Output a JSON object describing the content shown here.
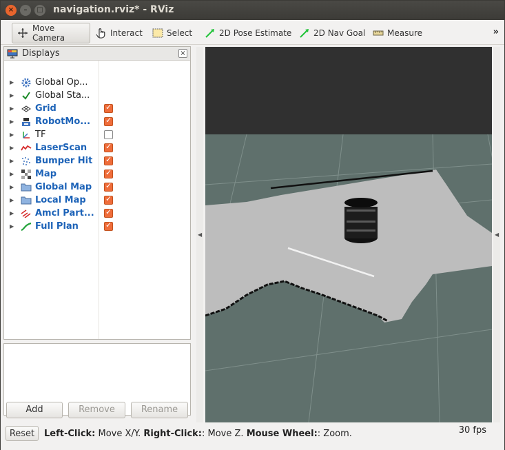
{
  "window": {
    "title": "navigation.rviz* - RViz"
  },
  "toolbar": {
    "tools": [
      {
        "label": "Move Camera",
        "icon": "move-camera-icon"
      },
      {
        "label": "Interact",
        "icon": "hand-pointer-icon"
      },
      {
        "label": "Select",
        "icon": "select-box-icon"
      },
      {
        "label": "2D Pose Estimate",
        "icon": "green-arrow-icon"
      },
      {
        "label": "2D Nav Goal",
        "icon": "green-arrow-icon"
      },
      {
        "label": "Measure",
        "icon": "ruler-icon"
      }
    ],
    "overflow": "»"
  },
  "displays": {
    "title": "Displays",
    "items": [
      {
        "label": "Global Op...",
        "checked": null,
        "style": "dark",
        "icon": "gear-icon"
      },
      {
        "label": "Global Sta...",
        "checked": null,
        "style": "dark",
        "icon": "checkmark-icon"
      },
      {
        "label": "Grid",
        "checked": true,
        "style": "blue",
        "icon": "grid-icon"
      },
      {
        "label": "RobotMo...",
        "checked": true,
        "style": "blue",
        "icon": "robot-model-icon"
      },
      {
        "label": "TF",
        "checked": false,
        "style": "dark",
        "icon": "tf-axes-icon"
      },
      {
        "label": "LaserScan",
        "checked": true,
        "style": "blue",
        "icon": "laser-scan-icon"
      },
      {
        "label": "Bumper Hit",
        "checked": true,
        "style": "blue",
        "icon": "point-cloud-icon"
      },
      {
        "label": "Map",
        "checked": true,
        "style": "blue",
        "icon": "map-icon"
      },
      {
        "label": "Global Map",
        "checked": true,
        "style": "blue",
        "icon": "folder-icon"
      },
      {
        "label": "Local Map",
        "checked": true,
        "style": "blue",
        "icon": "folder-icon"
      },
      {
        "label": "Amcl Part...",
        "checked": true,
        "style": "blue",
        "icon": "pose-array-icon"
      },
      {
        "label": "Full Plan",
        "checked": true,
        "style": "blue",
        "icon": "path-icon"
      }
    ],
    "buttons": {
      "add": "Add",
      "remove": "Remove",
      "rename": "Rename"
    }
  },
  "status": {
    "reset": "Reset",
    "help_parts": [
      "Left-Click:",
      " Move X/Y. ",
      "Right-Click:",
      ": Move Z. ",
      "Mouse Wheel:",
      ": Zoom."
    ],
    "fps": "30 fps"
  },
  "colors": {
    "checkbox_on": "#ef6d3b",
    "blue_label": "#1d63b8",
    "sky": "#303030",
    "ground": "#5f706c",
    "map_free": "#bdbdbd"
  }
}
